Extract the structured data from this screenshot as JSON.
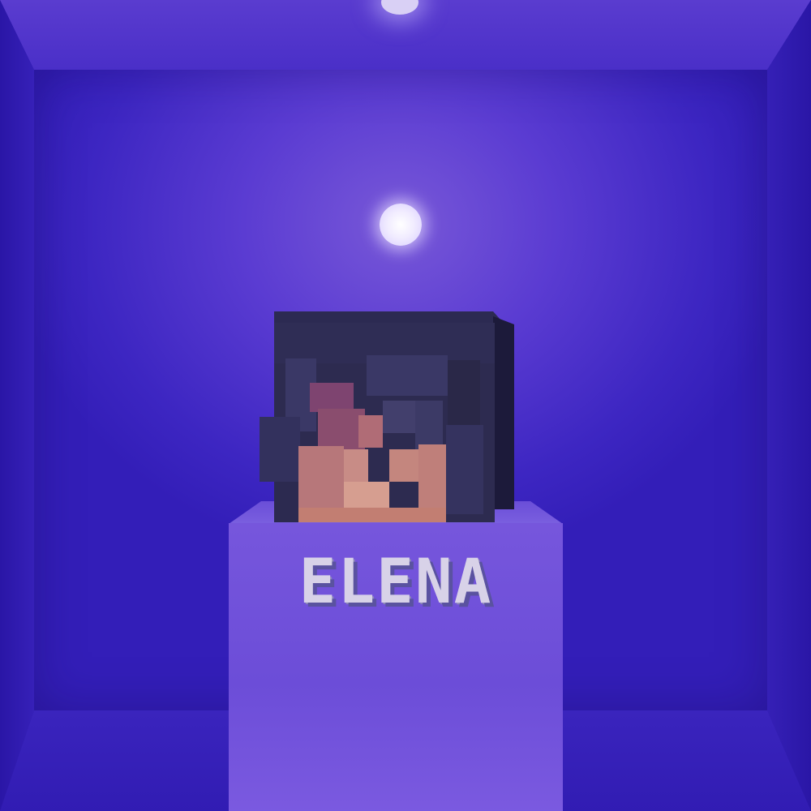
{
  "scene": {
    "label": "ELENA",
    "colors": {
      "room": "#3a22bf",
      "light": "#ffffff",
      "pedestal": "#7656dc",
      "label_text": "#d8d2e8",
      "hair": "#2d2b50",
      "skin": "#c4867e",
      "blush": "#7e4470"
    }
  }
}
